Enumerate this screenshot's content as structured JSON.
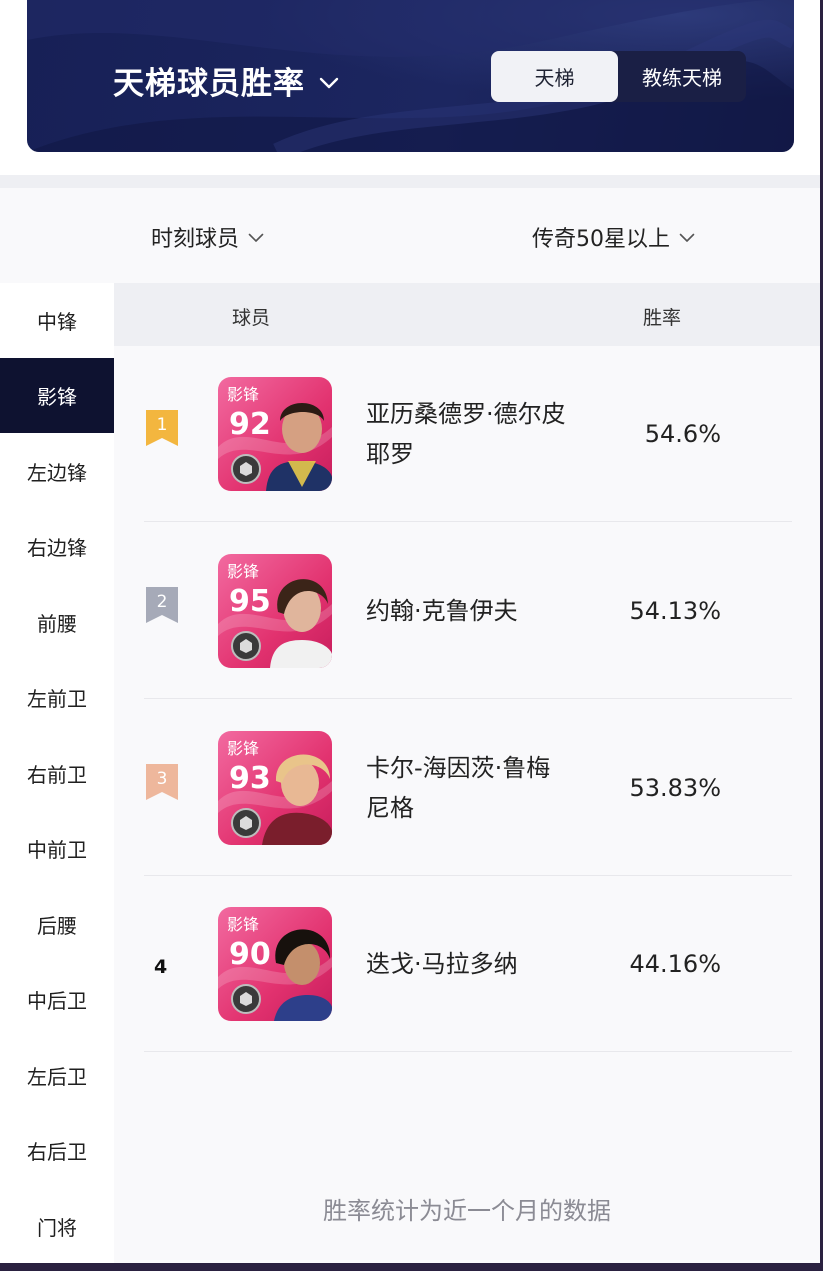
{
  "header": {
    "title": "天梯球员胜率",
    "tabs": [
      {
        "label": "天梯",
        "active": true
      },
      {
        "label": "教练天梯",
        "active": false
      }
    ]
  },
  "filters": {
    "card_type": "时刻球员",
    "tier": "传奇50星以上"
  },
  "positions": [
    "中锋",
    "影锋",
    "左边锋",
    "右边锋",
    "前腰",
    "左前卫",
    "右前卫",
    "中前卫",
    "后腰",
    "中后卫",
    "左后卫",
    "右后卫",
    "门将"
  ],
  "selected_position": "影锋",
  "table": {
    "col_player": "球员",
    "col_rate": "胜率"
  },
  "players": [
    {
      "rank": "1",
      "position": "影锋",
      "rating": "92",
      "name": "亚历桑德罗·德尔皮耶罗",
      "win_rate": "54.6%"
    },
    {
      "rank": "2",
      "position": "影锋",
      "rating": "95",
      "name": "约翰·克鲁伊夫",
      "win_rate": "54.13%"
    },
    {
      "rank": "3",
      "position": "影锋",
      "rating": "93",
      "name": "卡尔-海因茨·鲁梅尼格",
      "win_rate": "53.83%"
    },
    {
      "rank": "4",
      "position": "影锋",
      "rating": "90",
      "name": "迭戈·马拉多纳",
      "win_rate": "44.16%"
    }
  ],
  "footnote": "胜率统计为近一个月的数据",
  "colors": {
    "banner": "#1c2660",
    "nav_active": "#0e1230",
    "card_pink": "#e8327a",
    "gold": "#f3b63f",
    "silver": "#a6aab8",
    "bronze": "#eeb79c"
  }
}
